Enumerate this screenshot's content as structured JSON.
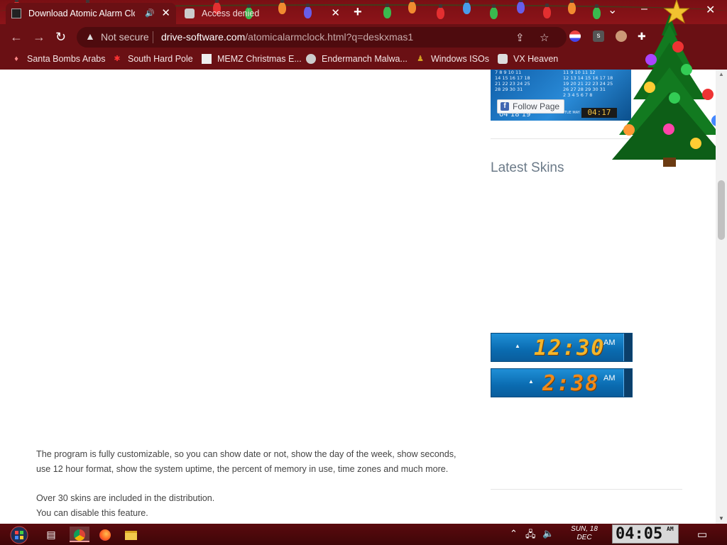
{
  "browser": {
    "tabs": [
      {
        "title": "Download Atomic Alarm Clo",
        "active": true,
        "audio": true
      },
      {
        "title": "Access denied",
        "active": false,
        "audio": false
      }
    ],
    "new_tab": "+",
    "window_controls": {
      "dropdown": "⌄",
      "minimize": "–",
      "maximize": "□",
      "close": "✕"
    },
    "nav": {
      "back": "←",
      "forward": "→",
      "reload": "↻"
    },
    "security": {
      "label": "Not secure",
      "icon": "warning-icon"
    },
    "url": {
      "host": "drive-software.com",
      "path": "/atomicalarmclock.html?q=deskxmas1"
    },
    "bookmarks": [
      {
        "label": "Santa Bombs Arabs",
        "icon": "santa-icon"
      },
      {
        "label": "South Hard Pole",
        "icon": "snowflake-icon"
      },
      {
        "label": "MEMZ Christmas E...",
        "icon": "window-icon"
      },
      {
        "label": "Endermanch Malwa...",
        "icon": "raccoon-icon"
      },
      {
        "label": "Windows ISOs",
        "icon": "figure-icon"
      },
      {
        "label": "VX Heaven",
        "icon": "shield-icon"
      }
    ]
  },
  "sidebar": {
    "fb_widget": {
      "follow_label": "Follow Page",
      "calendar_left": [
        "7  8  9  10  11",
        "14 15 16 17 18",
        "21 22 23 24 25",
        "28 29 30 31"
      ],
      "calendar_right": [
        "11  9  10  11  12",
        "12 13 14 15 16 17 18",
        "19 20 21 22 23 24 25",
        "26 27 28 29 30 31",
        "2  3  4  5  6  7  8"
      ],
      "mini_clock": "04:17",
      "date_text": "04 18 19",
      "small_date": "24 TUE MAY"
    },
    "latest_skins_title": "Latest Skins",
    "skins": [
      {
        "time": "12:30",
        "ampm": "AM"
      },
      {
        "time": "2:38",
        "ampm": "AM"
      }
    ]
  },
  "content": {
    "paragraphs": [
      [
        "The program is fully customizable, so you can show date or not, show the day of the week, show seconds,",
        "use 12 hour format, show the system uptime, the percent of memory in use, time zones and much more."
      ],
      [
        "Over 30 skins are included in the distribution.",
        "You can disable this feature."
      ]
    ]
  },
  "taskbar": {
    "tray_date_line1": "SUN, 18",
    "tray_date_line2": "DEC",
    "clock": "04:05",
    "clock_ampm": "AM"
  },
  "colors": {
    "chrome": "#6a1014",
    "accent": "#f3b52b",
    "skin_blue": "#0a6bb0"
  }
}
